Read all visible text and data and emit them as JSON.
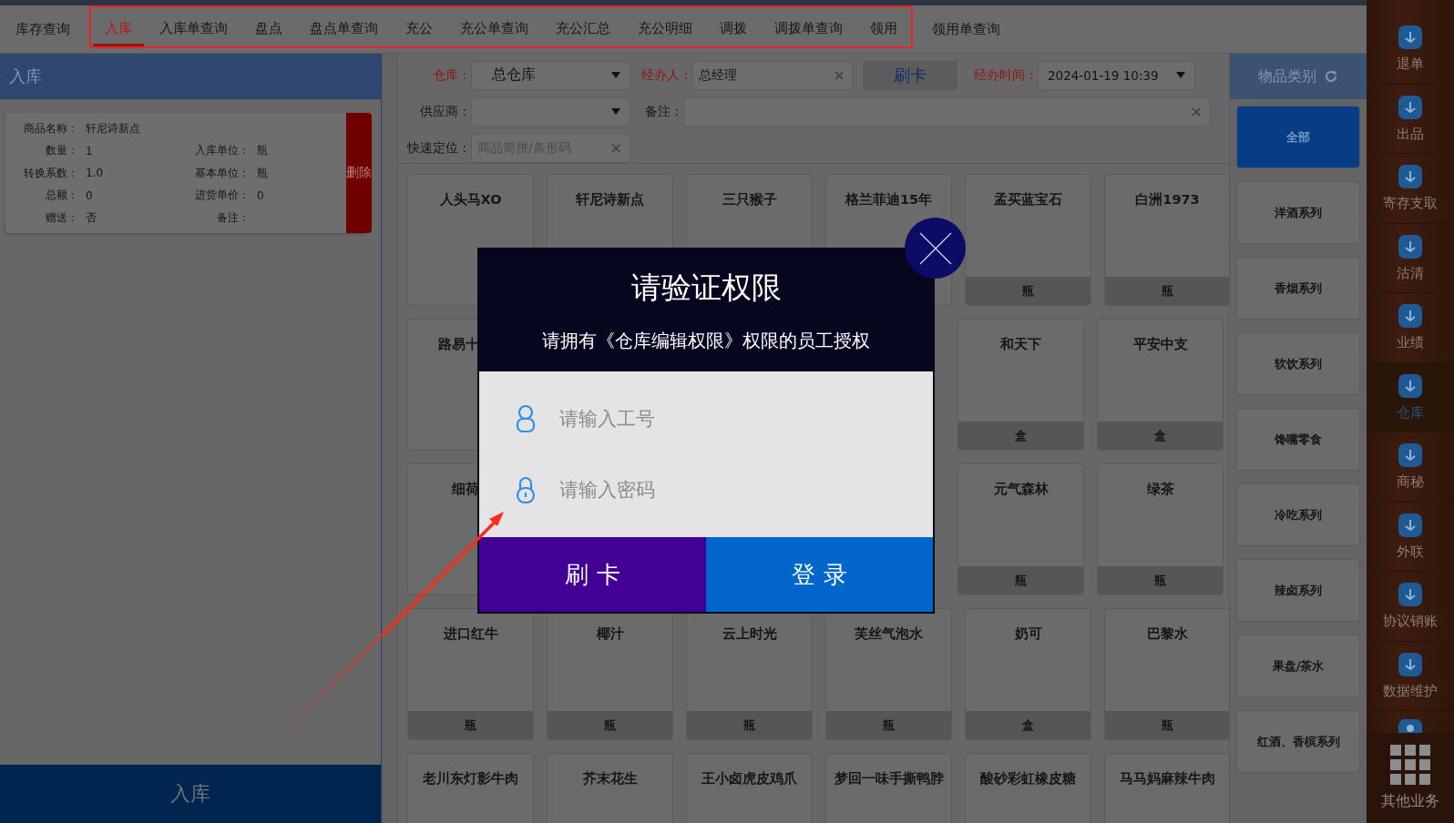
{
  "tab_groups": [
    {
      "highlighted": false,
      "tabs": [
        {
          "label": "库存查询",
          "selected": false
        }
      ]
    },
    {
      "highlighted": true,
      "tabs": [
        {
          "label": "入库",
          "selected": true
        },
        {
          "label": "入库单查询",
          "selected": false
        },
        {
          "label": "盘点",
          "selected": false
        },
        {
          "label": "盘点单查询",
          "selected": false
        },
        {
          "label": "充公",
          "selected": false
        },
        {
          "label": "充公单查询",
          "selected": false
        },
        {
          "label": "充公汇总",
          "selected": false
        },
        {
          "label": "充公明细",
          "selected": false
        },
        {
          "label": "调拨",
          "selected": false
        },
        {
          "label": "调拨单查询",
          "selected": false
        },
        {
          "label": "领用",
          "selected": false
        }
      ]
    },
    {
      "highlighted": false,
      "tabs": [
        {
          "label": "领用单查询",
          "selected": false
        }
      ]
    }
  ],
  "left_panel": {
    "title": "入库",
    "item": {
      "name_label": "商品名称：",
      "name": "轩尼诗新点",
      "fields": [
        {
          "label": "数量：",
          "value": "1"
        },
        {
          "label": "入库单位：",
          "value": "瓶"
        },
        {
          "label": "转换系数：",
          "value": "1.0"
        },
        {
          "label": "基本单位：",
          "value": "瓶"
        },
        {
          "label": "总额：",
          "value": "0"
        },
        {
          "label": "进货单价：",
          "value": "0"
        },
        {
          "label": "赠送：",
          "value": "否"
        },
        {
          "label": "备注："
        }
      ],
      "delete_button": "删除"
    },
    "submit_button": "入库"
  },
  "filters": {
    "warehouse": {
      "label": "仓库：",
      "value": "总仓库"
    },
    "handler": {
      "label": "经办人：",
      "value": "总经理",
      "clear": "×"
    },
    "card_button": "刷卡",
    "time": {
      "label": "经办时间：",
      "value": "2024-01-19 10:39"
    },
    "supplier": {
      "label": "供应商："
    },
    "remark": {
      "label": "备注：",
      "clear": "×"
    },
    "locate": {
      "label": "快速定位：",
      "placeholder": "商品简拼/条形码",
      "clear": "×"
    }
  },
  "products": [
    {
      "items": [
        {
          "name": "人头马XO"
        },
        {
          "name": "轩尼诗新点"
        },
        {
          "name": "三只猴子"
        },
        {
          "name": "格兰菲迪15年"
        },
        {
          "name": "孟买蓝宝石",
          "unit": "瓶"
        },
        {
          "name": "白洲1973",
          "unit": "瓶"
        }
      ]
    },
    {
      "left": [
        {
          "name": "路易十",
          "cut": true
        }
      ],
      "right": [
        {
          "name": "和天下",
          "unit": "盒"
        },
        {
          "name": "平安中支",
          "unit": "盒"
        }
      ]
    },
    {
      "left": [
        {
          "name": "细荷",
          "cut": true
        }
      ],
      "right": [
        {
          "name": "元气森林",
          "unit": "瓶"
        },
        {
          "name": "绿茶",
          "unit": "瓶"
        }
      ]
    },
    {
      "items": [
        {
          "name": "进口红牛",
          "unit": "瓶"
        },
        {
          "name": "椰汁",
          "unit": "瓶"
        },
        {
          "name": "云上时光",
          "unit": "瓶"
        },
        {
          "name": "芙丝气泡水",
          "unit": "瓶"
        },
        {
          "name": "奶可",
          "unit": "盒"
        },
        {
          "name": "巴黎水",
          "unit": "瓶"
        }
      ]
    },
    {
      "items": [
        {
          "name": "老川东灯影牛肉"
        },
        {
          "name": "芥末花生"
        },
        {
          "name": "王小卤虎皮鸡爪"
        },
        {
          "name": "梦回一味手撕鸭脖"
        },
        {
          "name": "酸砂彩虹橡皮糖"
        },
        {
          "name": "马马妈麻辣牛肉"
        }
      ]
    }
  ],
  "categories": {
    "title": "物品类别",
    "items": [
      {
        "label": "全部",
        "selected": true
      },
      {
        "label": "洋酒系列",
        "selected": false
      },
      {
        "label": "香烟系列",
        "selected": false
      },
      {
        "label": "软饮系列",
        "selected": false
      },
      {
        "label": "馋嘴零食",
        "selected": false
      },
      {
        "label": "冷吃系列",
        "selected": false
      },
      {
        "label": "辣卤系列",
        "selected": false
      },
      {
        "label": "果盘/茶水",
        "selected": false
      },
      {
        "label": "红酒、香槟系列",
        "selected": false
      }
    ]
  },
  "sidebar": {
    "items": [
      {
        "label": "退单",
        "selected": false
      },
      {
        "label": "出品",
        "selected": false
      },
      {
        "label": "寄存支取",
        "selected": false
      },
      {
        "label": "沽清",
        "selected": false
      },
      {
        "label": "业绩",
        "selected": false
      },
      {
        "label": "仓库",
        "selected": true
      },
      {
        "label": "商秘",
        "selected": false
      },
      {
        "label": "外联",
        "selected": false
      },
      {
        "label": "协议销账",
        "selected": false
      },
      {
        "label": "数据维护",
        "selected": false
      }
    ],
    "more": "其他业务"
  },
  "dialog": {
    "title": "请验证权限",
    "subtitle": "请拥有《仓库编辑权限》权限的员工授权",
    "fields": [
      {
        "kind": "user",
        "placeholder": "请输入工号"
      },
      {
        "kind": "lock",
        "placeholder": "请输入密码"
      }
    ],
    "buttons": [
      {
        "kind": "card",
        "label": "刷 卡"
      },
      {
        "kind": "login",
        "label": "登 录"
      }
    ]
  }
}
